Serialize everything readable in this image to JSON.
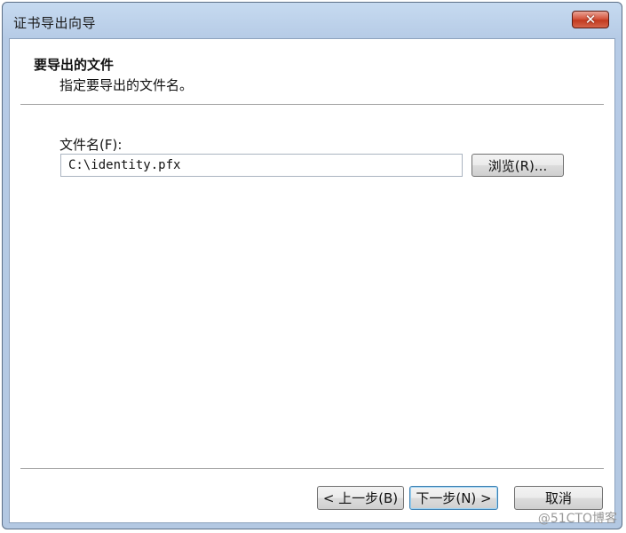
{
  "window": {
    "title": "证书导出向导",
    "close_glyph": "✕"
  },
  "header": {
    "title": "要导出的文件",
    "subtitle": "指定要导出的文件名。"
  },
  "form": {
    "file_label": "文件名(F):",
    "file_value": "C:\\identity.pfx",
    "browse_label": "浏览(R)..."
  },
  "footer": {
    "back_label": "< 上一步(B)",
    "next_label": "下一步(N) >",
    "cancel_label": "取消"
  },
  "watermark": "@51CTO博客",
  "icons": {
    "close": "close-icon"
  },
  "colors": {
    "frame": "#b6cbe6",
    "close_button": "#c23a1f",
    "focus_border": "#3c7fb1"
  }
}
